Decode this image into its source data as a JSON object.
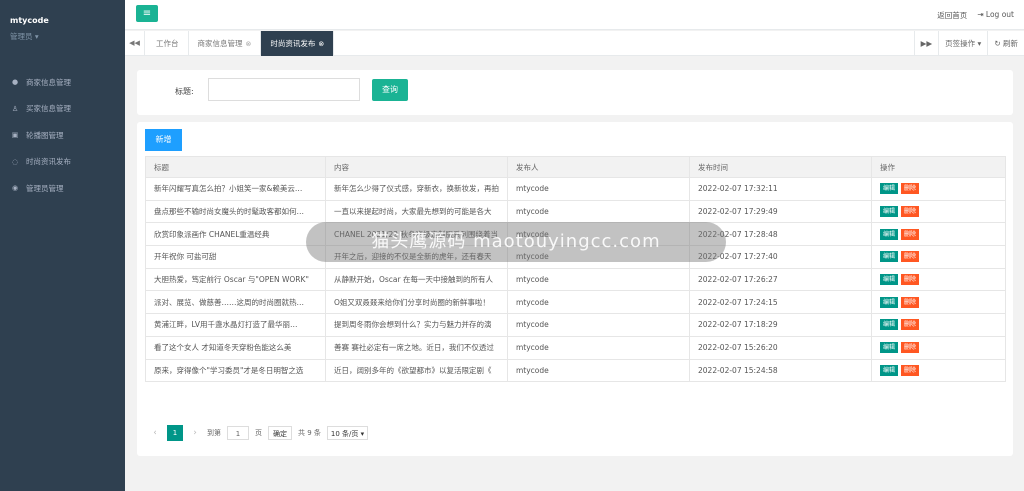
{
  "sidebar": {
    "brand": "mtycode",
    "role": "管理员 ▾",
    "items": [
      {
        "label": "商家信息管理",
        "icon": "user-circle-icon"
      },
      {
        "label": "买家信息管理",
        "icon": "user-icon"
      },
      {
        "label": "轮播图管理",
        "icon": "image-icon"
      },
      {
        "label": "时尚资讯发布",
        "icon": "chat-icon"
      },
      {
        "label": "管理员管理",
        "icon": "admin-icon"
      }
    ]
  },
  "header": {
    "menu_icon": "menu-icon",
    "home_link": "返回首页",
    "logout": "Log out"
  },
  "tabs": {
    "items": [
      "工作台",
      "商家信息管理",
      "时尚资讯发布"
    ],
    "active": 2,
    "page_ops": "页签操作 ▾",
    "refresh": "刷新"
  },
  "search": {
    "label": "标题:",
    "input_value": "",
    "button": "查询"
  },
  "table": {
    "add_button": "新增",
    "headers": [
      "标题",
      "内容",
      "发布人",
      "发布时间",
      "操作"
    ],
    "rows": [
      {
        "title": "新年闪耀写真怎么拍？小姐笑一家&赖美云…",
        "content": "新年怎么少得了仪式感，穿新衣，换新妆发，再拍",
        "publisher": "mtycode",
        "time": "2022-02-07 17:32:11"
      },
      {
        "title": "盘点那些不输时尚女魔头的时髦政客都如何…",
        "content": "一直以来提起时尚，大家最先想到的可能是各大",
        "publisher": "mtycode",
        "time": "2022-02-07 17:29:49"
      },
      {
        "title": "欣赏印象派画作 CHANEL重温经典",
        "content": "CHANEL 2021/22 秋冬高级定制服系列围绕着当",
        "publisher": "mtycode",
        "time": "2022-02-07 17:28:48"
      },
      {
        "title": "开年祝你 可盐可甜",
        "content": "开年之后，迎接的不仅是全新的虎年，还有春天",
        "publisher": "mtycode",
        "time": "2022-02-07 17:27:40"
      },
      {
        "title": "大胆热爱，笃定前行 Oscar 与\"OPEN WORK\"",
        "content": "从静默开始，Oscar 在每一天中接触到的所有人",
        "publisher": "mtycode",
        "time": "2022-02-07 17:26:27"
      },
      {
        "title": "派对、展览、做慈善……这周的时尚圈就热…",
        "content": "O姐又双叒叕来给你们分享时尚圈的新鲜事啦！",
        "publisher": "mtycode",
        "time": "2022-02-07 17:24:15"
      },
      {
        "title": "黄浦江畔，LV用千盏水晶灯打造了最华丽…",
        "content": "提到周冬雨你会想到什么？实力与魅力并存的演",
        "publisher": "mtycode",
        "time": "2022-02-07 17:18:29"
      },
      {
        "title": "看了这个女人 才知道冬天穿粉色能这么美",
        "content": "善赛 赛社必定有一席之地。近日，我们不仅透过",
        "publisher": "mtycode",
        "time": "2022-02-07 15:26:20"
      },
      {
        "title": "原来，穿得像个\"学习委员\"才是冬日明智之选",
        "content": "近日，阔别多年的《欲望都市》以复活限定剧《",
        "publisher": "mtycode",
        "time": "2022-02-07 15:24:58"
      }
    ],
    "edit_label": "编辑",
    "delete_label": "删除"
  },
  "pager": {
    "current": "1",
    "goto_label": "到第",
    "goto_value": "1",
    "page_unit": "页",
    "confirm": "确定",
    "total": "共 9 条",
    "page_size": "10 条/页 ▾"
  },
  "overlay": {
    "text": "猫头鹰源码 maotouyingcc.com"
  },
  "colors": {
    "sidebar_bg": "#2f4050",
    "primary": "#1ab394",
    "edit": "#009688",
    "delete": "#ff5722",
    "add": "#1e9fff"
  }
}
